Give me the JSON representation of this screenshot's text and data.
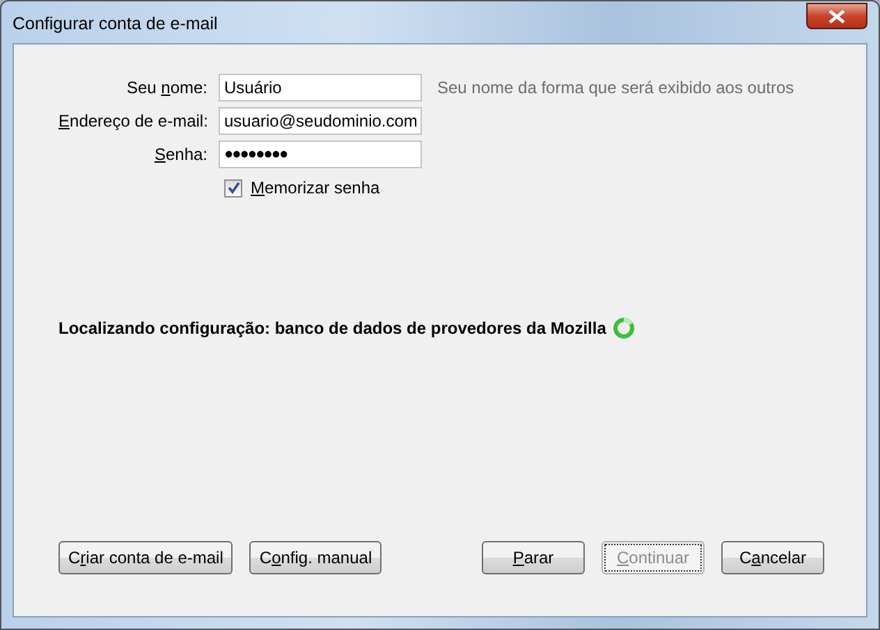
{
  "window": {
    "title": "Configurar conta de e-mail"
  },
  "fields": [
    {
      "label": {
        "pre": "Seu ",
        "key": "n",
        "post": "ome:"
      },
      "value": "Usuário",
      "kind": "text",
      "hint": "Seu nome da forma que será exibido aos outros"
    },
    {
      "label": {
        "key": "E",
        "post": "ndereço de e-mail:"
      },
      "value": "usuario@seudominio.com",
      "kind": "text"
    },
    {
      "label": {
        "key": "S",
        "post": "enha:"
      },
      "value": "●●●●●●●●",
      "kind": "password"
    }
  ],
  "remember": {
    "label": {
      "key": "M",
      "post": "emorizar senha"
    },
    "checked": true
  },
  "status": {
    "text": "Localizando configuração: banco de dados de provedores da Mozilla",
    "busy": true
  },
  "left_buttons": [
    {
      "label": {
        "pre": "C",
        "key": "r",
        "post": "iar conta de e-mail"
      },
      "disabled": false,
      "focused": false
    },
    {
      "label": {
        "pre": "C",
        "key": "o",
        "post": "nfig. manual"
      },
      "disabled": false,
      "focused": false
    }
  ],
  "right_buttons": [
    {
      "label": {
        "key": "P",
        "post": "arar"
      },
      "disabled": false,
      "focused": false
    },
    {
      "label": {
        "key": "C",
        "post": "ontinuar"
      },
      "disabled": true,
      "focused": true
    },
    {
      "label": {
        "pre": "C",
        "key": "a",
        "post": "ncelar"
      },
      "disabled": false,
      "focused": false
    }
  ]
}
